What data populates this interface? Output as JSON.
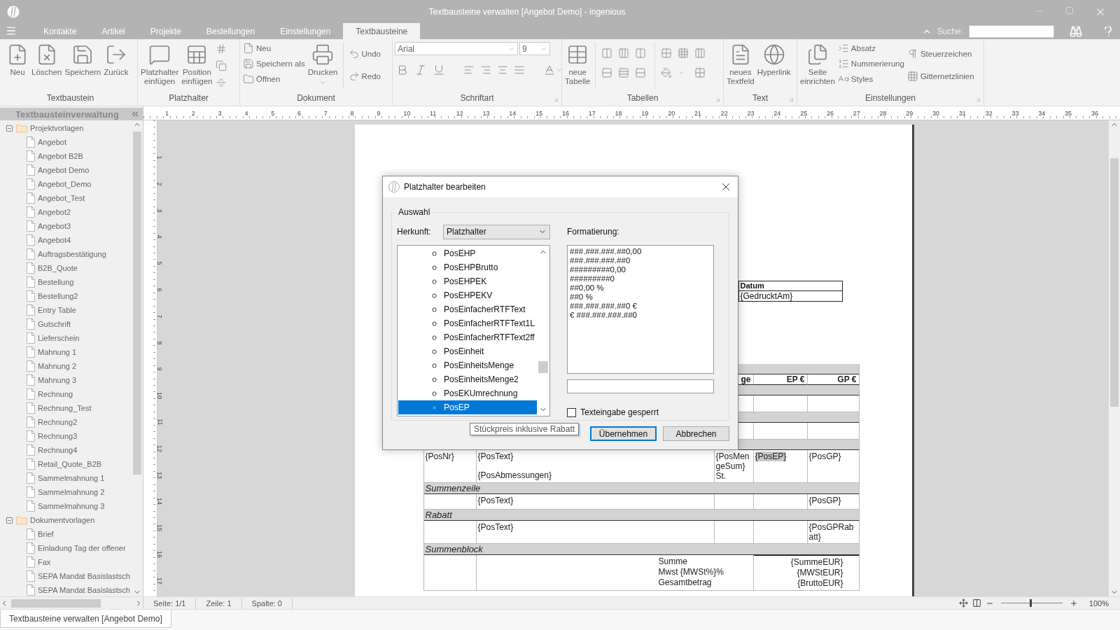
{
  "window": {
    "title": "Textbausteine verwalten [Angebot Demo] - ingenious"
  },
  "tabs": [
    {
      "label": "Kontakte",
      "selected": false
    },
    {
      "label": "Artikel",
      "selected": false
    },
    {
      "label": "Projekte",
      "selected": false
    },
    {
      "label": "Bestellungen",
      "selected": false
    },
    {
      "label": "Einstellungen",
      "selected": false
    },
    {
      "label": "Textbausteine",
      "selected": true
    }
  ],
  "search": {
    "label": "Suche:"
  },
  "ribbon": {
    "groups": [
      {
        "label": "Textbaustein",
        "buttons": [
          {
            "label": "Neu"
          },
          {
            "label": "Löschen"
          },
          {
            "label": "Speichern"
          },
          {
            "label": "Zurück"
          }
        ]
      },
      {
        "label": "Platzhalter",
        "buttons": [
          {
            "label": "Platzhalter einfügen"
          },
          {
            "label": "Position einfügen"
          }
        ]
      },
      {
        "label": "Dokument",
        "small": [
          {
            "label": "Neu"
          },
          {
            "label": "Speichern als"
          },
          {
            "label": "Öffnen"
          }
        ],
        "buttons": [
          {
            "label": "Drucken"
          }
        ],
        "history": [
          {
            "label": "Undo"
          },
          {
            "label": "Redo"
          }
        ]
      },
      {
        "label": "Schriftart",
        "font": "Arial",
        "size": "9"
      },
      {
        "label": "Tabellen",
        "buttons": [
          {
            "label": "neue Tabelle"
          }
        ]
      },
      {
        "label": "Text",
        "buttons": [
          {
            "label": "neues Textfeld"
          },
          {
            "label": "Hyperlink"
          }
        ]
      },
      {
        "label": "Einstellungen",
        "buttons": [
          {
            "label": "Seite einrichten"
          }
        ],
        "small": [
          {
            "label": "Absatz"
          },
          {
            "label": "Nummerierung"
          },
          {
            "label": "Styles"
          }
        ],
        "toggles": [
          {
            "label": "Steuerzeichen"
          },
          {
            "label": "Gitternetzlinien"
          }
        ]
      }
    ]
  },
  "sidebar": {
    "title": "Textbausteinverwaltung",
    "tree": [
      {
        "label": "Projektvorlagen",
        "expanded": true,
        "children": [
          {
            "label": "Angebot"
          },
          {
            "label": "Angebot B2B"
          },
          {
            "label": "Angebot Demo"
          },
          {
            "label": "Angebot_Demo"
          },
          {
            "label": "Angebot_Test"
          },
          {
            "label": "Angebot2"
          },
          {
            "label": "Angebot3"
          },
          {
            "label": "Angebot4"
          },
          {
            "label": "Auftragsbestätigung"
          },
          {
            "label": "B2B_Quote"
          },
          {
            "label": "Bestellung"
          },
          {
            "label": "Bestellung2"
          },
          {
            "label": "Entry Table"
          },
          {
            "label": "Gutschrift"
          },
          {
            "label": "Lieferschein"
          },
          {
            "label": "Mahnung 1"
          },
          {
            "label": "Mahnung 2"
          },
          {
            "label": "Mahnung 3"
          },
          {
            "label": "Rechnung"
          },
          {
            "label": "Rechnung_Test"
          },
          {
            "label": "Rechnung2"
          },
          {
            "label": "Rechnung3"
          },
          {
            "label": "Rechnung4"
          },
          {
            "label": "Retail_Quote_B2B"
          },
          {
            "label": "Sammelmahnung 1"
          },
          {
            "label": "Sammelmahnung 2"
          },
          {
            "label": "Sammelmahnung 3"
          }
        ]
      },
      {
        "label": "Dokumentvorlagen",
        "expanded": true,
        "children": [
          {
            "label": "Brief"
          },
          {
            "label": "Einladung Tag der offener"
          },
          {
            "label": "Fax"
          },
          {
            "label": "SEPA Mandat Basislastsch"
          },
          {
            "label": "SEPA Mandat Basislastsch"
          }
        ]
      }
    ]
  },
  "rulers": {
    "horizontal": [
      "1",
      "2",
      "3",
      "4",
      "5",
      "6",
      "7",
      "8",
      "9",
      "10",
      "11",
      "12",
      "13",
      "14",
      "15",
      "16",
      "17",
      "18",
      "19",
      "20",
      "21",
      "22",
      "23",
      "24",
      "25",
      "26",
      "27",
      "28",
      "29",
      "30",
      "31",
      "32",
      "33",
      "34",
      "35",
      "36"
    ],
    "vertical": [
      "1",
      "2",
      "3",
      "4",
      "5",
      "6",
      "7",
      "8",
      "9",
      "10",
      "11",
      "12",
      "13",
      "14",
      "15",
      "16",
      "17"
    ]
  },
  "document": {
    "date_table": {
      "header": "Datum",
      "value": "{GedrucktAm}"
    },
    "rows": [
      {
        "kind": "band"
      },
      {
        "kind": "header",
        "cells": {
          "column_3": "ge",
          "column_4": "EP €",
          "column_5": "GP €"
        }
      },
      {
        "kind": "band"
      },
      {
        "kind": "row"
      },
      {
        "kind": "band"
      },
      {
        "kind": "row"
      },
      {
        "kind": "band"
      },
      {
        "kind": "row",
        "cells": {
          "column_1": "{PosNr}",
          "column_2": [
            "{PosText}",
            "{PosAbmessungen}"
          ],
          "column_3": "{PosMengeSum} St.",
          "column_4": {
            "text": "{PosEP}",
            "highlighted": true
          },
          "column_5": "{PosGP}"
        }
      },
      {
        "kind": "band",
        "label": "Summenzeile"
      },
      {
        "kind": "row",
        "cells": {
          "column_2": "{PosText}",
          "column_5": "{PosGP}"
        }
      },
      {
        "kind": "band",
        "label": "Rabatt"
      },
      {
        "kind": "row",
        "cells": {
          "column_2": "{PosText}",
          "column_5": "{PosGPRabatt}"
        }
      },
      {
        "kind": "band",
        "label": "Summenblock"
      },
      {
        "kind": "totals",
        "labels": [
          "Summe",
          "Mwst {MWSt%}%",
          "Gesamtbetrag"
        ],
        "values": [
          "{SummeEUR}",
          "{MWStEUR}",
          "{BruttoEUR}"
        ]
      }
    ]
  },
  "dialog": {
    "title": "Platzhalter bearbeiten",
    "group": "Auswahl",
    "source_label": "Herkunft:",
    "source": "Platzhalter",
    "format_label": "Formatierung:",
    "items": [
      {
        "label": "PosEHP",
        "selected": false
      },
      {
        "label": "PosEHPBrutto",
        "selected": false
      },
      {
        "label": "PosEHPEK",
        "selected": false
      },
      {
        "label": "PosEHPEKV",
        "selected": false
      },
      {
        "label": "PosEinfacherRTFText",
        "selected": false
      },
      {
        "label": "PosEinfacherRTFText1L",
        "selected": false
      },
      {
        "label": "PosEinfacherRTFText2ff",
        "selected": false
      },
      {
        "label": "PosEinheit",
        "selected": false
      },
      {
        "label": "PosEinheitsMenge",
        "selected": false
      },
      {
        "label": "PosEinheitsMenge2",
        "selected": false
      },
      {
        "label": "PosEKUmrechnung",
        "selected": false
      },
      {
        "label": "PosEP",
        "selected": true
      }
    ],
    "formats": [
      "###.###.###.##0,00",
      "###.###.###.##0",
      "#########0,00",
      "#########0",
      "##0,00 %",
      "##0 %",
      "###.###.###.##0 €",
      "€ ###.###.###.##0"
    ],
    "locked": {
      "label": "Texteingabe gesperrt",
      "checked": false
    },
    "tooltip": "Stückpreis inklusive Rabatt",
    "buttons": [
      {
        "label": "Übernehmen",
        "default": true
      },
      {
        "label": "Abbrechen",
        "default": false
      }
    ]
  },
  "status_bar": {
    "items": [
      "Seite: 1/1",
      "Zeile: 1",
      "Spalte: 0"
    ],
    "zoom": {
      "level": 0.48,
      "reading": "100%"
    }
  },
  "taskbar": {
    "tab": "Textbausteine verwalten [Angebot Demo]"
  }
}
